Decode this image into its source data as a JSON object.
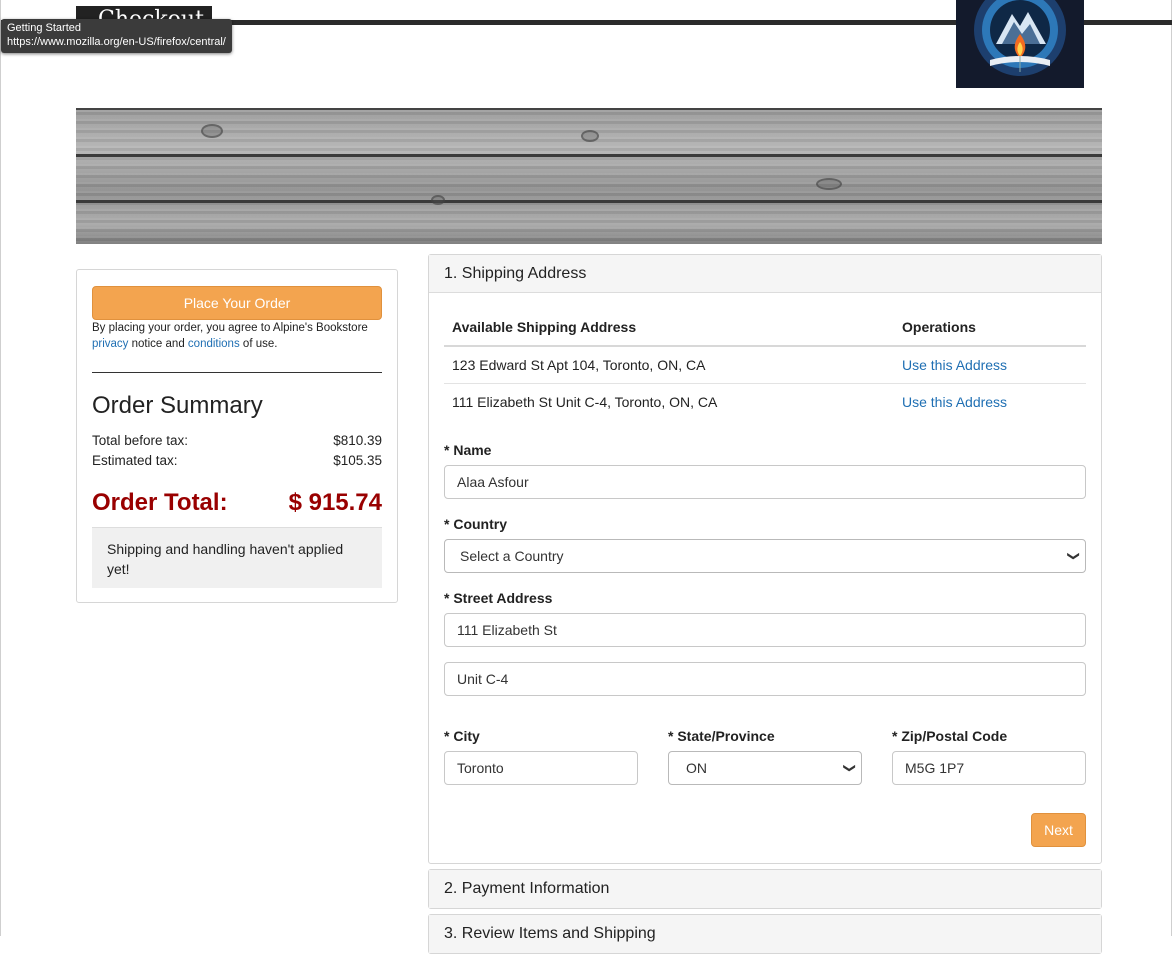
{
  "header": {
    "title": "Checkout",
    "tooltip_title": "Getting Started",
    "tooltip_url": "https://www.mozilla.org/en-US/firefox/central/"
  },
  "summary": {
    "place_order_label": "Place Your Order",
    "agree_prefix": "By placing your order, you agree to Alpine's Bookstore",
    "privacy_link": "privacy",
    "notice_and": "notice and",
    "conditions_link": "conditions",
    "of_use": "of use.",
    "title": "Order Summary",
    "before_tax_label": "Total before tax:",
    "before_tax_value": "$810.39",
    "tax_label": "Estimated tax:",
    "tax_value": "$105.35",
    "total_label": "Order Total:",
    "total_value": "$ 915.74",
    "shipping_note": "Shipping and handling haven't applied yet!"
  },
  "shipping": {
    "heading": "1. Shipping Address",
    "table_headers": [
      "Available Shipping Address",
      "Operations"
    ],
    "addresses": [
      {
        "address": "123 Edward St Apt 104, Toronto, ON, CA",
        "op": "Use this Address"
      },
      {
        "address": "111 Elizabeth St Unit C-4, Toronto, ON, CA",
        "op": "Use this Address"
      }
    ],
    "name_label": "* Name",
    "name_value": "Alaa Asfour",
    "country_label": "* Country",
    "country_value": "Select a Country",
    "street_label": "* Street Address",
    "street_line1": "111 Elizabeth St",
    "street_line2": "Unit C-4",
    "city_label": "* City",
    "city_value": "Toronto",
    "state_label": "* State/Province",
    "state_value": "ON",
    "zip_label": "* Zip/Postal Code",
    "zip_value": "M5G 1P7",
    "next_label": "Next"
  },
  "sections": {
    "payment": "2. Payment Information",
    "review": "3. Review Items and Shipping"
  },
  "colors": {
    "accent_orange": "#f3a44f",
    "total_red": "#990000",
    "link_blue": "#1f6fb3"
  }
}
